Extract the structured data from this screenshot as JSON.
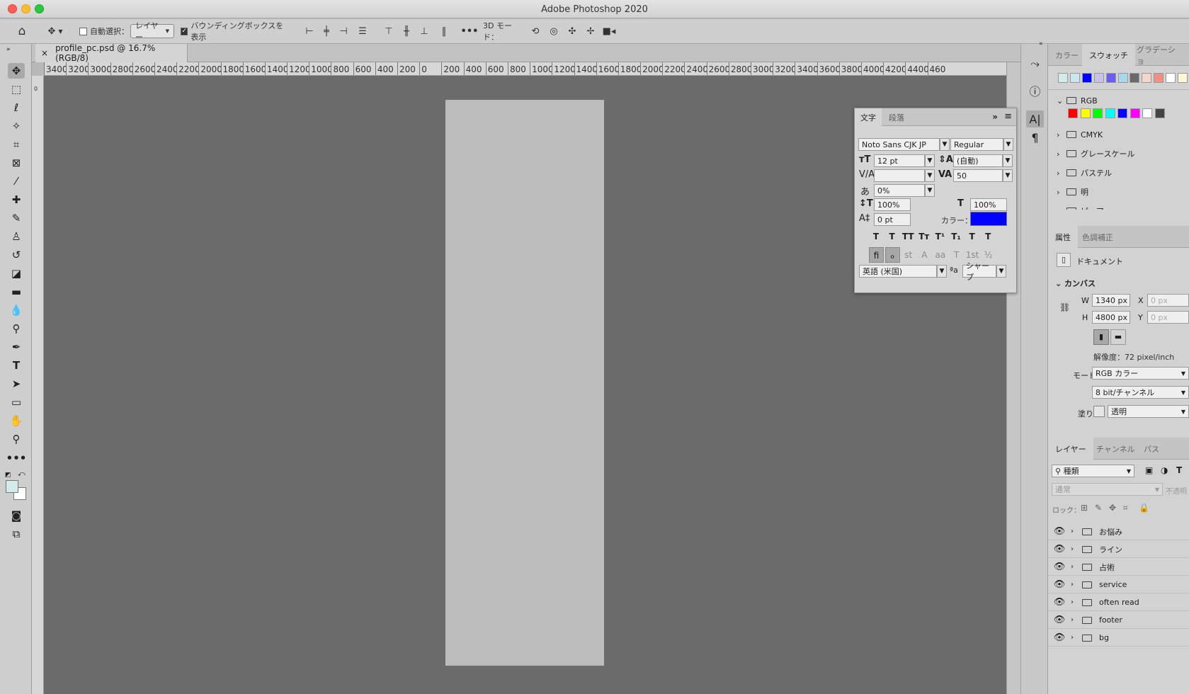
{
  "window": {
    "title": "Adobe Photoshop 2020"
  },
  "options": {
    "auto_select": "自動選択：",
    "layer_mode": "レイヤー",
    "bbox_label": "バウンディングボックスを表示",
    "three_d": "3D モード："
  },
  "document": {
    "tab_title": "profile_pc.psd @ 16.7% (RGB/8)",
    "close": "×"
  },
  "ruler": {
    "ticks": [
      "3400",
      "3200",
      "3000",
      "2800",
      "2600",
      "2400",
      "2200",
      "2000",
      "1800",
      "1600",
      "1400",
      "1200",
      "1000",
      "800",
      "600",
      "400",
      "200",
      "0",
      "200",
      "400",
      "600",
      "800",
      "1000",
      "1200",
      "1400",
      "1600",
      "1800",
      "2000",
      "2200",
      "2400",
      "2600",
      "2800",
      "3000",
      "3200",
      "3400",
      "3600",
      "3800",
      "4000",
      "4200",
      "4400",
      "460"
    ]
  },
  "character": {
    "tabs": [
      "文字",
      "段落"
    ],
    "font_family": "Noto Sans CJK JP",
    "font_style": "Regular",
    "size": "12 pt",
    "leading": "(自動)",
    "kerning": "",
    "tracking": "50",
    "tsume": "0%",
    "vscale": "100%",
    "hscale": "100%",
    "baseline": "0 pt",
    "color_label": "カラー：",
    "color": "#0000ff",
    "language": "英語 (米国)",
    "aa": "シャープ",
    "style_buttons": [
      "T",
      "T",
      "TT",
      "Tт",
      "T¹",
      "T₁",
      "T",
      "T"
    ],
    "ot_buttons": [
      "fi",
      "ℴ",
      "st",
      "A",
      "aa",
      "T",
      "1st",
      "½"
    ]
  },
  "swatches": {
    "tabs": [
      "カラー",
      "スウォッチ",
      "グラデーショ"
    ],
    "recent": [
      "#d3ecea",
      "#cce6f0",
      "#0000ff",
      "#c9c0e8",
      "#6a5cf0",
      "#a9d7ec",
      "#6a6a6a",
      "#f5d4c9",
      "#ef8f86",
      "#ffffff",
      "#fff6d6"
    ],
    "groups": [
      {
        "name": "RGB",
        "open": true,
        "colors": [
          "#ff0000",
          "#ffff00",
          "#00ff00",
          "#00ffff",
          "#0000ff",
          "#ff00ff",
          "#ffffff",
          "#444444"
        ]
      },
      {
        "name": "CMYK"
      },
      {
        "name": "グレースケール"
      },
      {
        "name": "パステル"
      },
      {
        "name": "明"
      },
      {
        "name": "ピュア"
      }
    ]
  },
  "properties": {
    "tabs": [
      "属性",
      "色調補正"
    ],
    "doc_label": "ドキュメント",
    "canvas_label": "カンバス",
    "w_label": "W",
    "w": "1340 px",
    "h_label": "H",
    "h": "4800 px",
    "x_label": "X",
    "x": "0 px",
    "y_label": "Y",
    "y": "0 px",
    "resolution": "解像度：72 pixel/inch",
    "mode_label": "モード",
    "mode": "RGB カラー",
    "depth": "8 bit/チャンネル",
    "fill_label": "塗り",
    "fill": "透明"
  },
  "layers": {
    "tabs": [
      "レイヤー",
      "チャンネル",
      "パス"
    ],
    "filter": "種類",
    "blend": "通常",
    "opacity_label": "不透明",
    "lock_label": "ロック：",
    "items": [
      "お悩み",
      "ライン",
      "占術",
      "service",
      "often read",
      "footer",
      "bg"
    ]
  }
}
